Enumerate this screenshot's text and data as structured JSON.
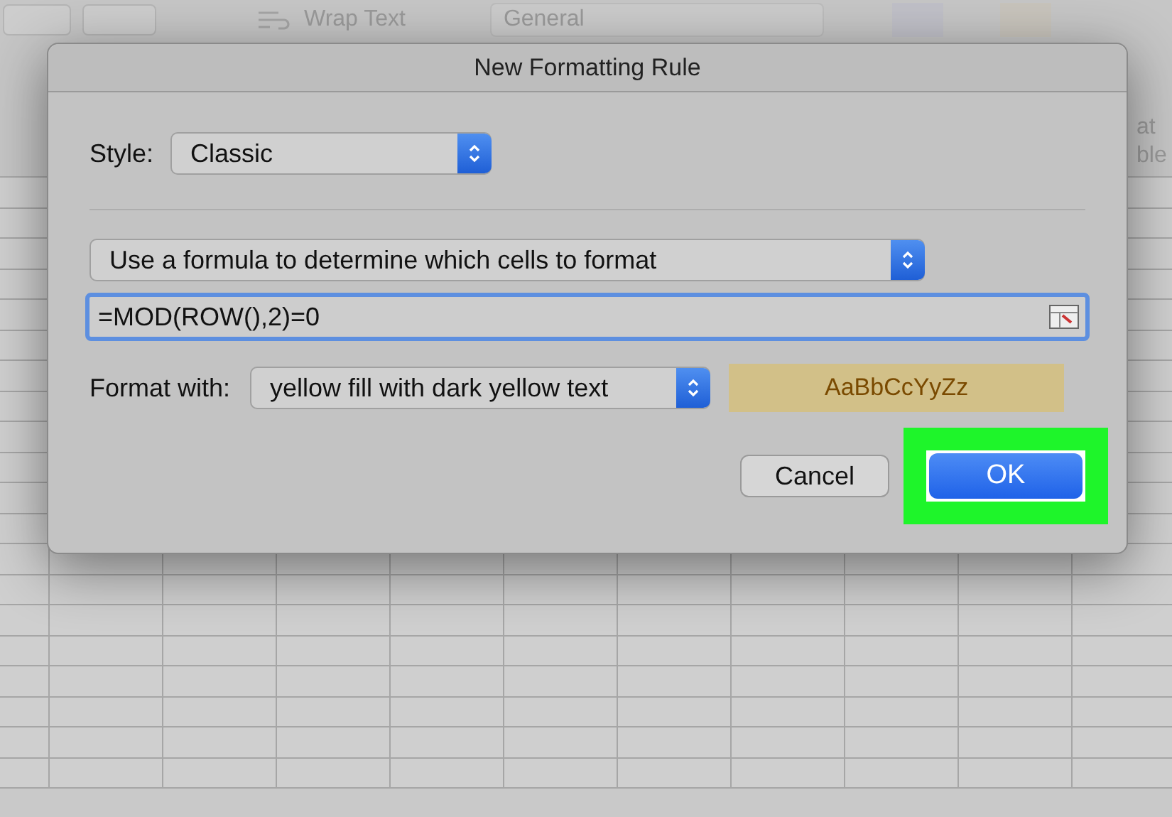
{
  "ribbon": {
    "wrap_text": "Wrap Text",
    "number_format": "General",
    "cut_label_lines": [
      "at",
      "ble"
    ]
  },
  "dialog": {
    "title": "New Formatting Rule",
    "style_label": "Style:",
    "style_value": "Classic",
    "rule_type": "Use a formula to determine which cells to format",
    "formula": "=MOD(ROW(),2)=0",
    "format_label": "Format with:",
    "format_value": "yellow fill with dark yellow text",
    "preview": "AaBbCcYyZz",
    "buttons": [
      {
        "label": "Cancel",
        "kind": "secondary",
        "highlighted": false
      },
      {
        "label": "OK",
        "kind": "primary",
        "highlighted": true
      }
    ]
  }
}
